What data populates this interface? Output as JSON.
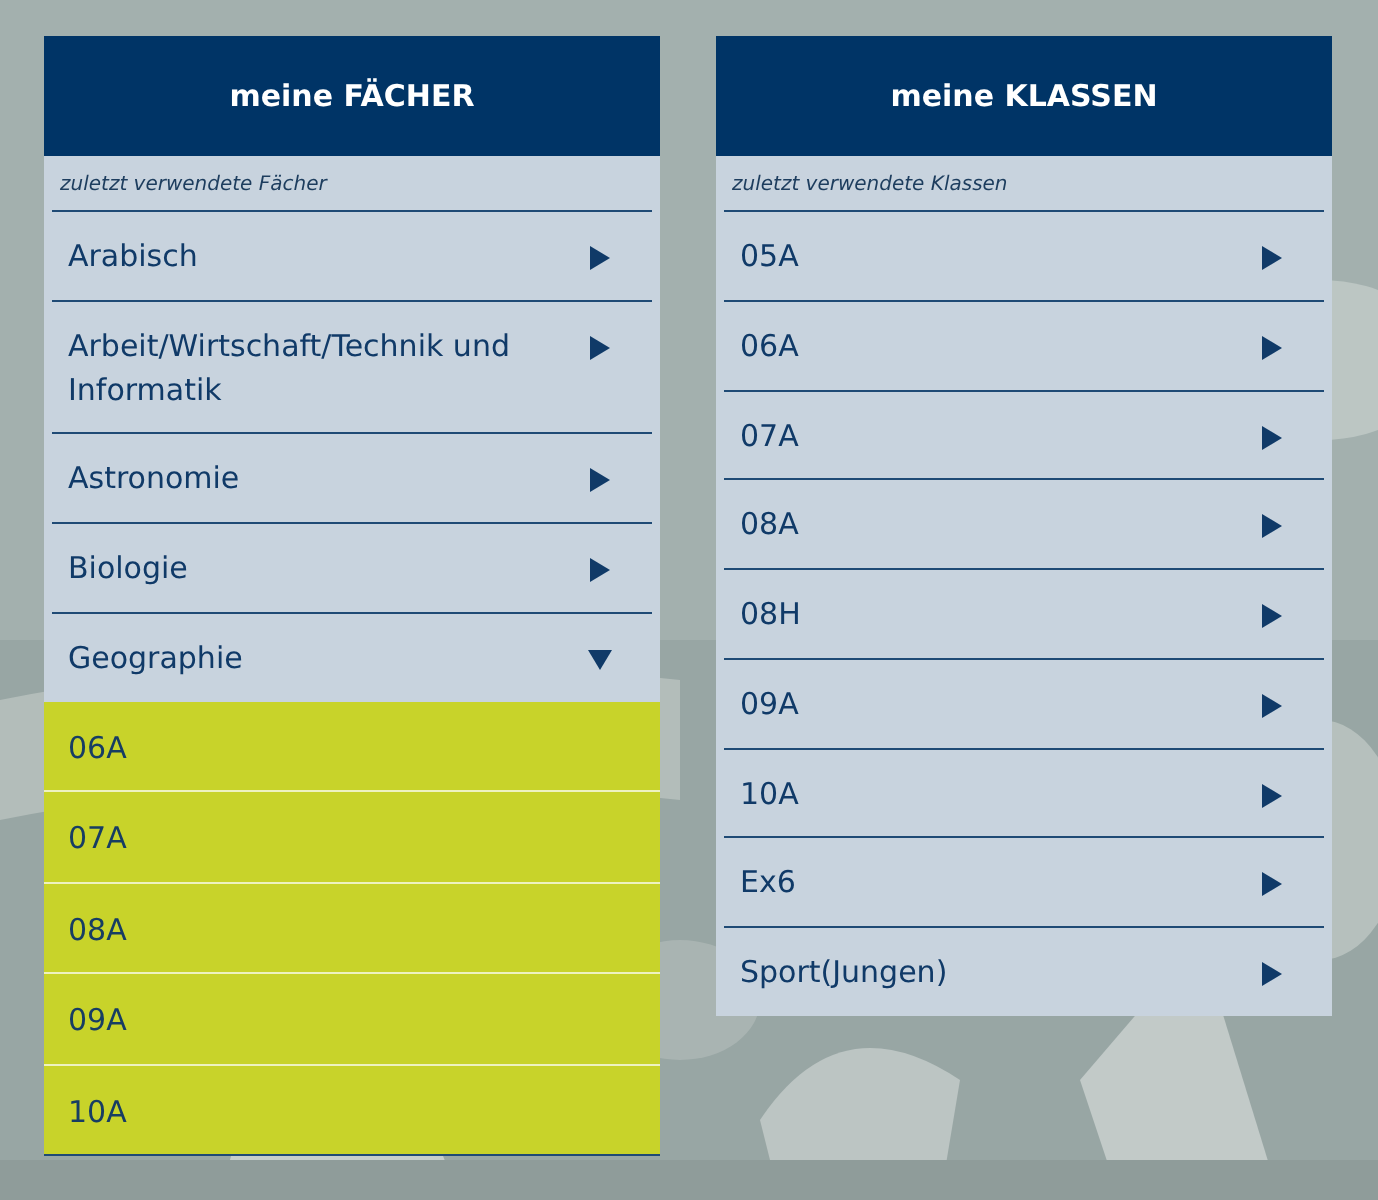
{
  "panels": [
    {
      "title": "meine FÄCHER",
      "subtitle": "zuletzt verwendete Fächer",
      "items": [
        {
          "label": "Arabisch",
          "expanded": false
        },
        {
          "label": "Arbeit/Wirtschaft/Technik und Informatik",
          "expanded": false
        },
        {
          "label": "Astronomie",
          "expanded": false
        },
        {
          "label": "Biologie",
          "expanded": false
        },
        {
          "label": "Geographie",
          "expanded": true,
          "children": [
            {
              "label": "06A"
            },
            {
              "label": "07A"
            },
            {
              "label": "08A"
            },
            {
              "label": "09A"
            },
            {
              "label": "10A"
            }
          ]
        }
      ]
    },
    {
      "title": "meine KLASSEN",
      "subtitle": "zuletzt verwendete Klassen",
      "items": [
        {
          "label": "05A",
          "expanded": false
        },
        {
          "label": "06A",
          "expanded": false
        },
        {
          "label": "07A",
          "expanded": false
        },
        {
          "label": "08A",
          "expanded": false
        },
        {
          "label": "08H",
          "expanded": false
        },
        {
          "label": "09A",
          "expanded": false
        },
        {
          "label": "10A",
          "expanded": false
        },
        {
          "label": "Ex6",
          "expanded": false
        },
        {
          "label": "Sport(Jungen)",
          "expanded": false
        }
      ]
    }
  ]
}
